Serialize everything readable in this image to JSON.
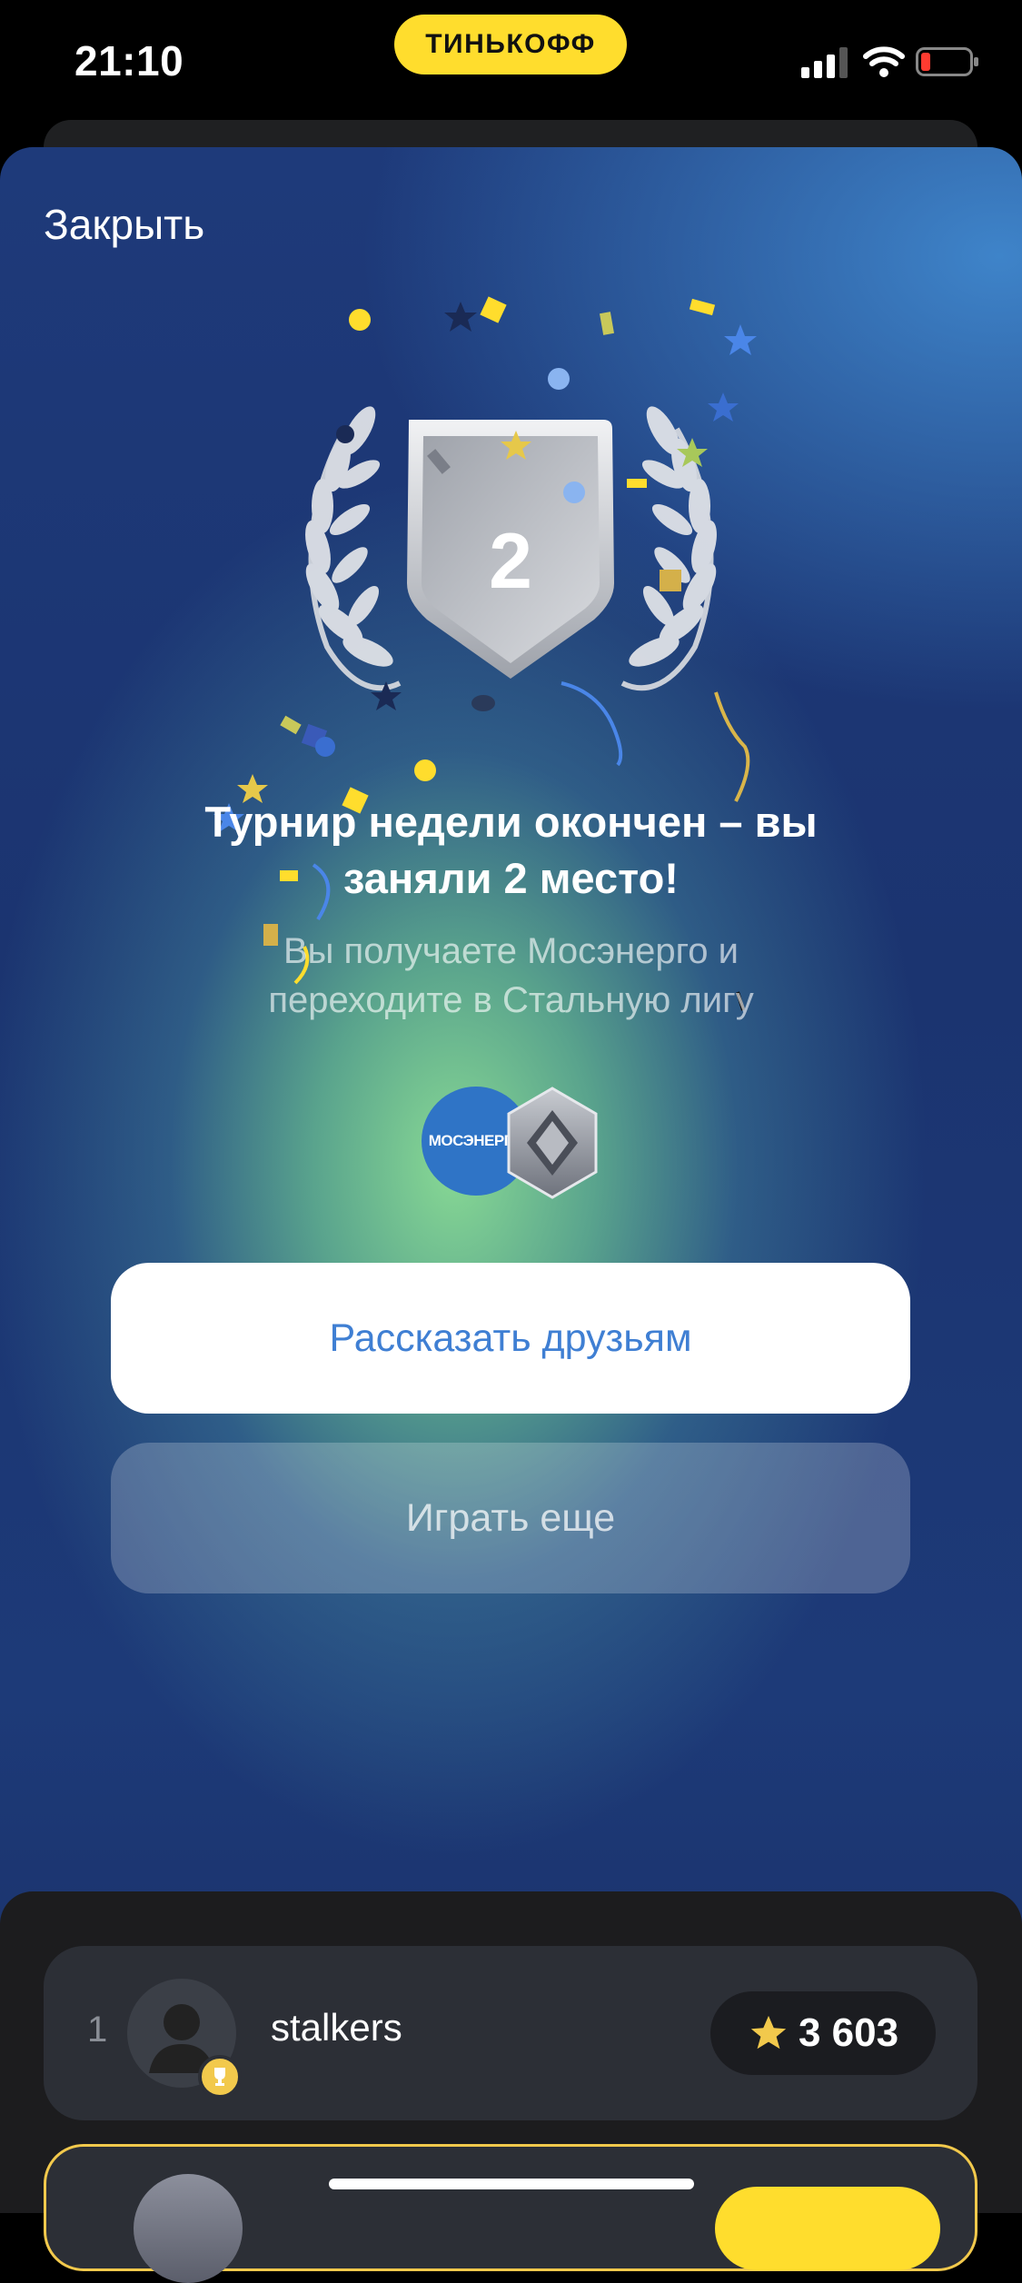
{
  "status_bar": {
    "time": "21:10",
    "bank_name": "ТИНЬКОФФ",
    "icons": [
      "signal-icon",
      "wifi-icon",
      "battery-low-icon"
    ]
  },
  "modal": {
    "close_label": "Закрыть",
    "place_number": "2",
    "title": "Турнир недели окончен – вы заняли 2 место!",
    "subtitle": "Вы получаете Мосэнерго и переходите в Стальную лигу",
    "reward_logo_text": "МОСЭНЕРГО",
    "share_button": "Рассказать друзьям",
    "play_button": "Играть еще"
  },
  "leaderboard": {
    "rows": [
      {
        "rank": "1",
        "name": "stalkers",
        "score": "3 603"
      }
    ]
  },
  "colors": {
    "bank_yellow": "#ffdd2d",
    "share_text_blue": "#3f7fd3",
    "trophy_gold": "#f2c94c",
    "star_gold": "#f2c94c"
  }
}
